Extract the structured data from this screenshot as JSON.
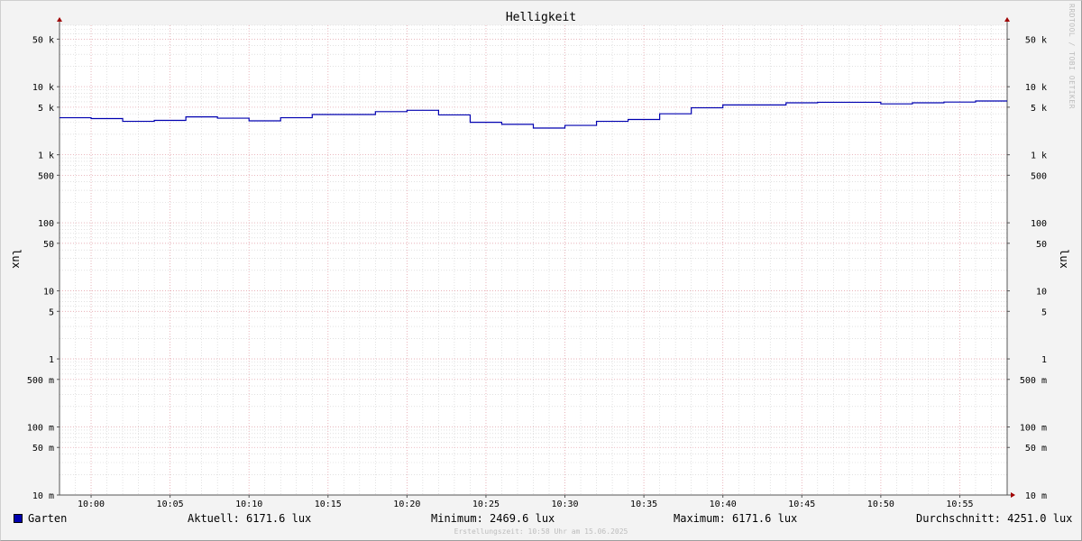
{
  "chart_data": {
    "type": "line",
    "title": "Helligkeit",
    "ylabel": "lux",
    "yscale": "log",
    "ylim": [
      0.01,
      80000
    ],
    "y_ticks": [
      {
        "value": 0.01,
        "label": "10 m"
      },
      {
        "value": 0.05,
        "label": "50 m"
      },
      {
        "value": 0.1,
        "label": "100 m"
      },
      {
        "value": 0.5,
        "label": "500 m"
      },
      {
        "value": 1,
        "label": "1"
      },
      {
        "value": 5,
        "label": "5"
      },
      {
        "value": 10,
        "label": "10"
      },
      {
        "value": 50,
        "label": "50"
      },
      {
        "value": 100,
        "label": "100"
      },
      {
        "value": 500,
        "label": "500"
      },
      {
        "value": 1000,
        "label": "1 k"
      },
      {
        "value": 5000,
        "label": "5 k"
      },
      {
        "value": 10000,
        "label": "10 k"
      },
      {
        "value": 50000,
        "label": "50 k"
      }
    ],
    "x_ticks": [
      "10:00",
      "10:05",
      "10:10",
      "10:15",
      "10:20",
      "10:25",
      "10:30",
      "10:35",
      "10:40",
      "10:45",
      "10:50",
      "10:55"
    ],
    "xlim": [
      "09:58",
      "10:58"
    ],
    "grid": true,
    "series": [
      {
        "name": "Garten",
        "color": "#0000b0",
        "step": true,
        "x": [
          "09:58",
          "10:00",
          "10:02",
          "10:04",
          "10:06",
          "10:08",
          "10:10",
          "10:12",
          "10:14",
          "10:16",
          "10:18",
          "10:20",
          "10:22",
          "10:24",
          "10:26",
          "10:28",
          "10:30",
          "10:32",
          "10:34",
          "10:36",
          "10:38",
          "10:40",
          "10:42",
          "10:44",
          "10:46",
          "10:48",
          "10:50",
          "10:52",
          "10:54",
          "10:56"
        ],
        "values": [
          3500,
          3400,
          3100,
          3200,
          3600,
          3450,
          3150,
          3500,
          3900,
          3900,
          4300,
          4500,
          3850,
          3000,
          2800,
          2469.6,
          2700,
          3100,
          3300,
          4000,
          4900,
          5400,
          5400,
          5800,
          5900,
          5900,
          5600,
          5800,
          5950,
          6171.6
        ]
      }
    ],
    "legend_position": "bottom-left",
    "stats": {
      "current": "Aktuell: 6171.6 lux",
      "minimum": "Minimum: 2469.6 lux",
      "maximum": "Maximum: 6171.6 lux",
      "average": "Durchschnitt: 4251.0 lux"
    },
    "footer": "Erstellungszeit: 10:58 Uhr am 15.06.2025",
    "watermark": "RRDTOOL / TOBI OETIKER"
  },
  "colors": {
    "background": "#f3f3f3",
    "plot_background": "#ffffff",
    "major_grid": "#e8a8b0",
    "minor_grid": "#cfcfcf",
    "series": "#0000b0",
    "axis": "#555555",
    "arrow": "#a00000"
  }
}
